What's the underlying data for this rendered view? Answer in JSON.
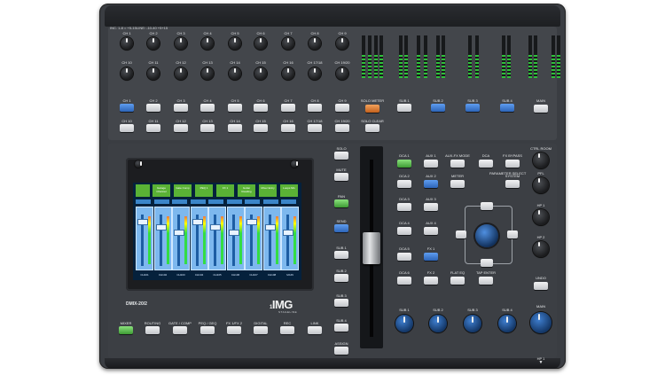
{
  "device": {
    "model": "DMIX-20/2",
    "brand": "IMG",
    "brand_prefix": "1",
    "brand_sub": "STAGELINE"
  },
  "upper": {
    "header_note_left": "INC. 1-8 = +5-15",
    "header_note_mid": "LINE: -10-40 +5+15",
    "knob_row1_labels": [
      "CH 1",
      "CH 2",
      "CH 3",
      "CH 4",
      "CH 5",
      "CH 6",
      "CH 7",
      "CH 8",
      "CH 9"
    ],
    "knob_row2_labels": [
      "CH 10",
      "CH 11",
      "CH 12",
      "CH 13",
      "CH 14",
      "CH 15",
      "CH 16",
      "CH 17/18",
      "CH 19/20"
    ],
    "button_row1_labels": [
      "CH 1",
      "CH 2",
      "CH 3",
      "CH 4",
      "CH 5",
      "CH 6",
      "CH 7",
      "CH 8",
      "CH 9"
    ],
    "button_row2_labels": [
      "CH 10",
      "CH 11",
      "CH 12",
      "CH 13",
      "CH 14",
      "CH 15",
      "CH 16",
      "CH 17/18",
      "CH 19/20"
    ],
    "solo_meter": "SOLO METER",
    "solo_clear": "SOLO CLEAR",
    "subs": [
      "SUB 1",
      "SUB 2",
      "SUB 3",
      "SUB 4"
    ],
    "main": "MAIN"
  },
  "screen": {
    "subtitle": "OUTPUT",
    "headers": [
      "Garage Channel",
      "Gate Comp",
      "PEQ 1",
      "FX 1",
      "Guitar Reading",
      "Mixer Entry",
      "Loops Mix"
    ],
    "channel_names": [
      "CH101",
      "CH102",
      "CH103",
      "CH104",
      "CH105",
      "CH106",
      "CH107",
      "CH108",
      "MAIN"
    ]
  },
  "right_col": [
    "SOLO",
    "MUTE",
    "PAN",
    "SEND",
    "SUB 1",
    "SUB 2",
    "SUB 3",
    "SUB 4",
    "ASSIGN"
  ],
  "dca": {
    "labels": [
      "DCA 1",
      "DCA 2",
      "DCA 3",
      "DCA 4",
      "DCA 5",
      "DCA 6"
    ],
    "aux": [
      "AUX 1",
      "AUX 2",
      "AUX 3",
      "AUX 4",
      "FX 1",
      "FX 2"
    ],
    "col3": [
      "AUX-FX MODE",
      "METER",
      "",
      "",
      "",
      "FLAT EQ"
    ],
    "col4": [
      "DCA",
      "",
      "",
      "",
      "",
      "TAP ENTER"
    ],
    "col5": [
      "FX BYPASS",
      "SYSTEM",
      "",
      "",
      "",
      ""
    ],
    "note": "PARAMETER SELECT"
  },
  "knobs_right": [
    "CTRL ROOM",
    "PFL",
    "HP 1",
    "HP 2"
  ],
  "undo": "UNDO",
  "bottom_subs": [
    "SUB 1",
    "SUB 2",
    "SUB 3",
    "SUB 4"
  ],
  "main_big": "MAIN",
  "hp_label": "HP 1",
  "bottom_buttons": [
    "MIXER",
    "ROUTING",
    "GATE / COMP",
    "PEQ / GEQ",
    "FX 1/FX 2",
    "DIGITAL",
    "REC",
    "LINK"
  ]
}
